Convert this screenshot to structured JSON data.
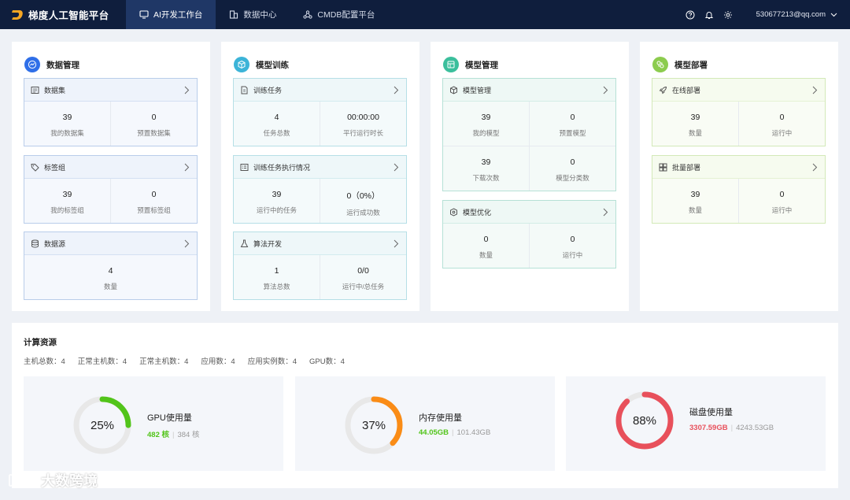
{
  "header": {
    "brand": "梯度人工智能平台",
    "nav": [
      "AI开发工作台",
      "数据中心",
      "CMDB配置平台"
    ],
    "account": "530677213@qq.com"
  },
  "colors": {
    "topbar": "#0f1e3d",
    "nav_active": "#1f3766",
    "gpu": "#52c41a",
    "memory": "#fa8c16",
    "disk": "#e8505b"
  },
  "data_mgmt": {
    "title": "数据管理",
    "datasets": {
      "title": "数据集",
      "v1": "39",
      "l1": "我的数据集",
      "v2": "0",
      "l2": "预置数据集"
    },
    "labels": {
      "title": "标签组",
      "v1": "39",
      "l1": "我的标签组",
      "v2": "0",
      "l2": "预置标签组"
    },
    "sources": {
      "title": "数据源",
      "v1": "4",
      "l1": "数量"
    }
  },
  "training": {
    "title": "模型训练",
    "tasks": {
      "title": "训练任务",
      "v1": "4",
      "l1": "任务总数",
      "v2": "00:00:00",
      "l2": "平行运行时长"
    },
    "exec": {
      "title": "训练任务执行情况",
      "v1": "39",
      "l1": "运行中的任务",
      "v2": "0（0%）",
      "l2": "运行成功数"
    },
    "algo": {
      "title": "算法开发",
      "v1": "1",
      "l1": "算法总数",
      "v2": "0/0",
      "l2": "运行中/总任务"
    }
  },
  "models": {
    "title": "模型管理",
    "mgmt": {
      "title": "模型管理",
      "v1": "39",
      "l1": "我的模型",
      "v2": "0",
      "l2": "预置模型",
      "v3": "39",
      "l3": "下载次数",
      "v4": "0",
      "l4": "模型分类数"
    },
    "opt": {
      "title": "模型优化",
      "v1": "0",
      "l1": "数量",
      "v2": "0",
      "l2": "运行中"
    }
  },
  "deploy": {
    "title": "模型部署",
    "online": {
      "title": "在线部署",
      "v1": "39",
      "l1": "数量",
      "v2": "0",
      "l2": "运行中"
    },
    "batch": {
      "title": "批量部署",
      "v1": "39",
      "l1": "数量",
      "v2": "0",
      "l2": "运行中"
    }
  },
  "compute": {
    "title": "计算资源",
    "stats": [
      "主机总数：4",
      "正常主机数：4",
      "正常主机数：4",
      "应用数：4",
      "应用实例数：4",
      "GPU数：4"
    ],
    "gpu": {
      "percent": "25%",
      "fraction": 0.25,
      "title": "GPU使用量",
      "used": "482 核",
      "total": "384 核"
    },
    "memory": {
      "percent": "37%",
      "fraction": 0.37,
      "title": "内存使用量",
      "used": "44.05GB",
      "total": "101.43GB"
    },
    "disk": {
      "percent": "88%",
      "fraction": 0.88,
      "title": "磁盘使用量",
      "used": "3307.59GB",
      "total": "4243.53GB"
    }
  },
  "watermark": "大数跨境"
}
